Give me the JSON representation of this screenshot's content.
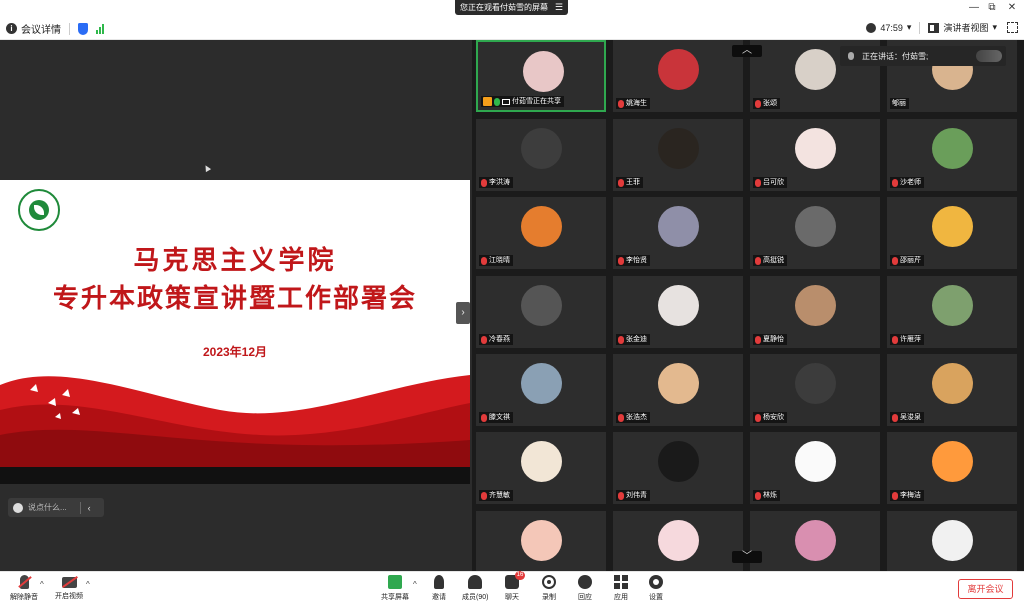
{
  "window": {
    "share_banner": "您正在观看付茹雪的屏幕",
    "minimize": "—",
    "restore": "⧉",
    "close": "✕"
  },
  "topbar": {
    "meeting_info": "会议详情",
    "timer": "47:59",
    "view_mode": "演讲者视图"
  },
  "slide": {
    "title_line1": "马克思主义学院",
    "title_line2": "专升本政策宣讲暨工作部署会",
    "date": "2023年12月"
  },
  "chat_input": {
    "placeholder": "说点什么..."
  },
  "speaking": {
    "label": "正在讲话：付茹雪;"
  },
  "participants": [
    {
      "name": "付茹雪正在共享",
      "mic": "on",
      "host": true,
      "sharing": true,
      "active": true
    },
    {
      "name": "姚海生",
      "mic": "off"
    },
    {
      "name": "张颂",
      "mic": "off"
    },
    {
      "name": "郇丽",
      "mic": "none"
    },
    {
      "name": "李洪涛",
      "mic": "off"
    },
    {
      "name": "王菲",
      "mic": "off"
    },
    {
      "name": "吕可欣",
      "mic": "off"
    },
    {
      "name": "沙老师",
      "mic": "off"
    },
    {
      "name": "江晓晴",
      "mic": "off"
    },
    {
      "name": "李怡贤",
      "mic": "off"
    },
    {
      "name": "高挺锐",
      "mic": "off"
    },
    {
      "name": "邵丽芹",
      "mic": "off"
    },
    {
      "name": "冷春燕",
      "mic": "off"
    },
    {
      "name": "张金迪",
      "mic": "off"
    },
    {
      "name": "夏静怡",
      "mic": "off"
    },
    {
      "name": "许雁萍",
      "mic": "off"
    },
    {
      "name": "滕文祺",
      "mic": "off"
    },
    {
      "name": "张浩杰",
      "mic": "off"
    },
    {
      "name": "杨安欣",
      "mic": "off"
    },
    {
      "name": "吴浚泉",
      "mic": "off"
    },
    {
      "name": "齐慧敏",
      "mic": "off"
    },
    {
      "name": "刘伟青",
      "mic": "off"
    },
    {
      "name": "林烁",
      "mic": "off"
    },
    {
      "name": "李梅洁",
      "mic": "off"
    },
    {
      "name": "",
      "mic": "none"
    },
    {
      "name": "",
      "mic": "none"
    },
    {
      "name": "",
      "mic": "none"
    },
    {
      "name": "",
      "mic": "none"
    }
  ],
  "toolbar": {
    "unmute": "解除静音",
    "start_video": "开启视频",
    "share_screen": "共享屏幕",
    "invite": "邀请",
    "members": "成员(90)",
    "chat": "聊天",
    "chat_badge": "16",
    "record": "录制",
    "reactions": "回应",
    "apps": "应用",
    "settings": "设置",
    "leave": "离开会议"
  }
}
